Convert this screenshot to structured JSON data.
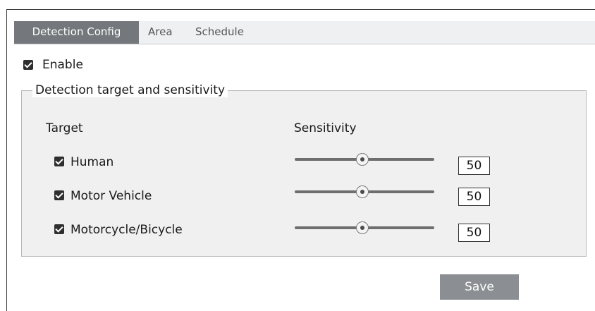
{
  "tabs": [
    {
      "label": "Detection Config",
      "active": true
    },
    {
      "label": "Area",
      "active": false
    },
    {
      "label": "Schedule",
      "active": false
    }
  ],
  "enable": {
    "label": "Enable",
    "checked": true
  },
  "group": {
    "legend": "Detection target and sensitivity",
    "target_header": "Target",
    "sensitivity_header": "Sensitivity",
    "rows": [
      {
        "label": "Human",
        "checked": true,
        "sensitivity": "50"
      },
      {
        "label": "Motor Vehicle",
        "checked": true,
        "sensitivity": "50"
      },
      {
        "label": "Motorcycle/Bicycle",
        "checked": true,
        "sensitivity": "50"
      }
    ]
  },
  "save_label": "Save"
}
